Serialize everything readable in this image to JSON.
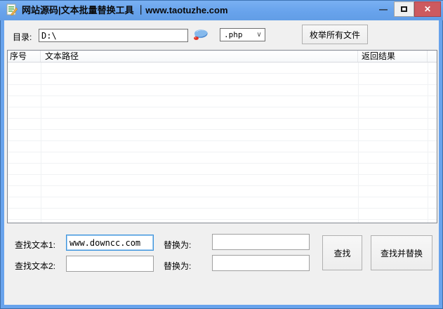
{
  "window": {
    "title": "网站源码|文本批量替换工具 ｜www.taotuzhe.com",
    "controls": {
      "minimize_glyph": "—",
      "close_glyph": "✕"
    }
  },
  "toolbar": {
    "dir_label": "目录:",
    "dir_value": "D:\\",
    "ext_selected": ".php",
    "combo_chevron": "∨",
    "enum_button_label": "枚举所有文件"
  },
  "list": {
    "columns": [
      {
        "label": "序号"
      },
      {
        "label": "文本路径"
      },
      {
        "label": "返回结果"
      }
    ],
    "rows": []
  },
  "search_panel": {
    "find1_label": "查找文本1:",
    "find1_value": "www.downcc.com",
    "replace1_label": "替换为:",
    "replace1_value": "",
    "find2_label": "查找文本2:",
    "find2_value": "",
    "replace2_label": "替换为:",
    "replace2_value": "",
    "find_button_label": "查找",
    "find_replace_button_label": "查找并替换"
  },
  "colors": {
    "titlebar_blue": "#68a3ec",
    "close_red": "#cd5a5f",
    "client_gray": "#f0f0f0",
    "focus_border_blue": "#3a93dd",
    "list_border": "#828790"
  }
}
